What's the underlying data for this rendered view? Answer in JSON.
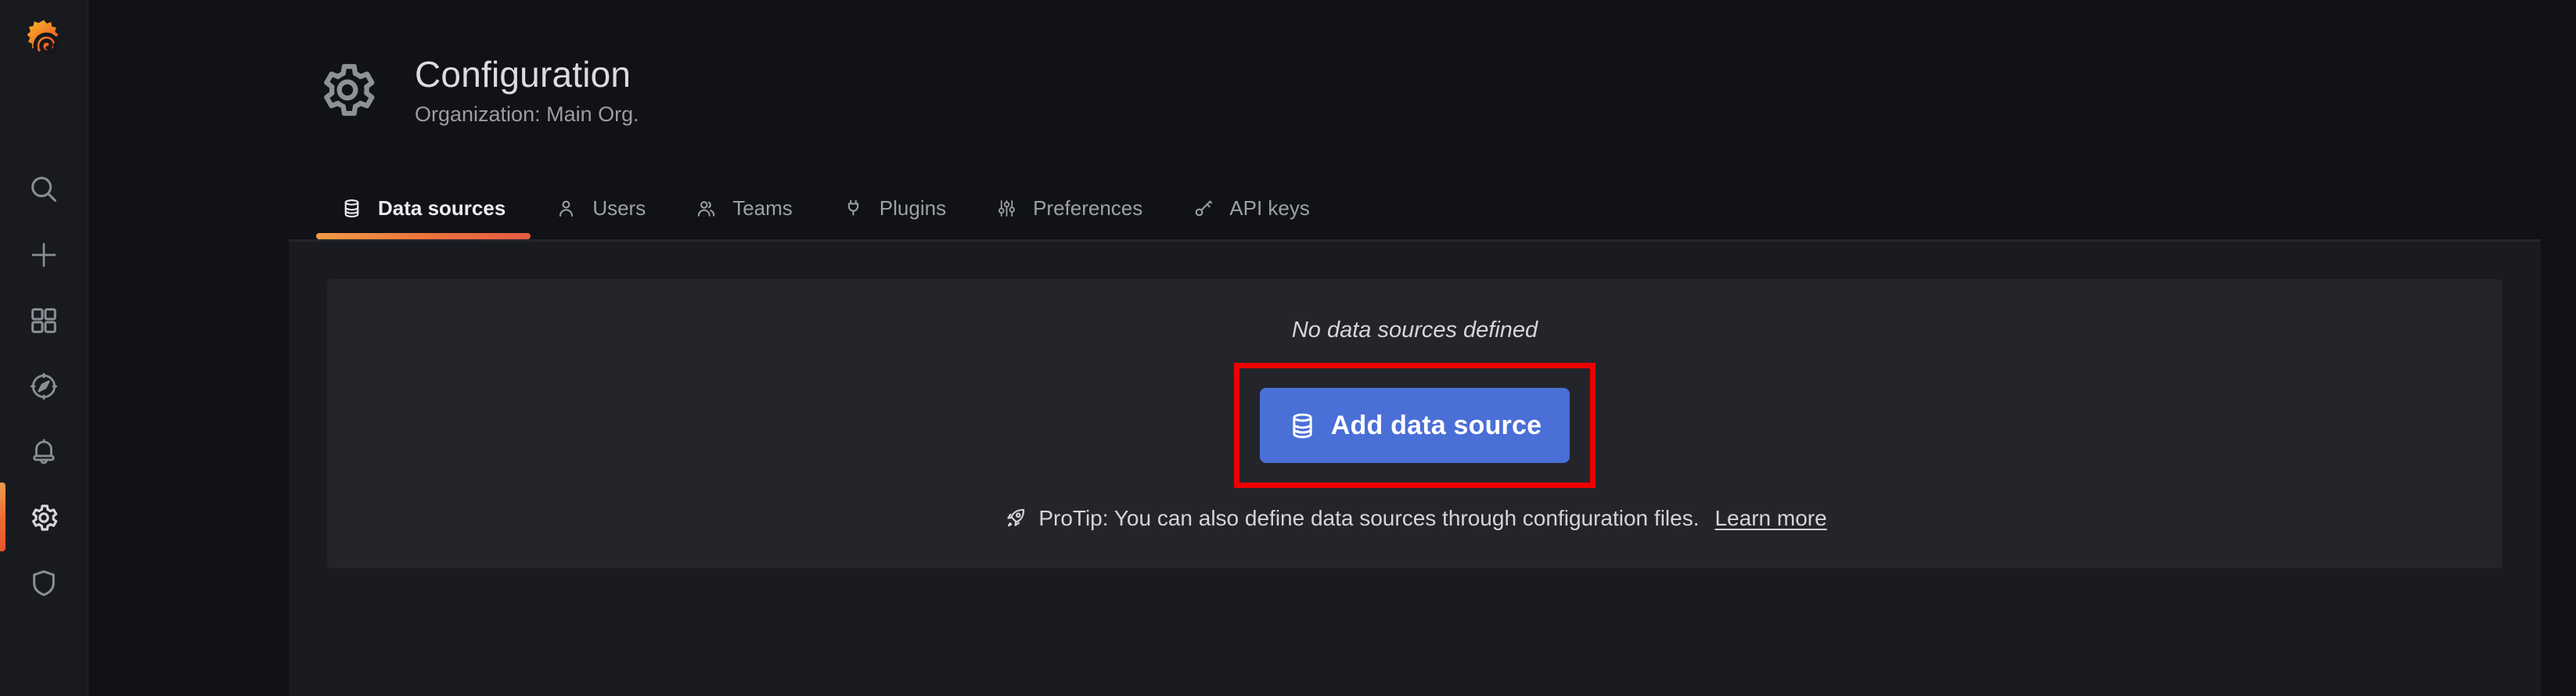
{
  "header": {
    "title": "Configuration",
    "subtitle": "Organization: Main Org."
  },
  "sidebar": {
    "items": [
      {
        "icon": "grafana-logo"
      },
      {
        "icon": "search-icon"
      },
      {
        "icon": "plus-icon"
      },
      {
        "icon": "dashboards-grid-icon"
      },
      {
        "icon": "explore-compass-icon"
      },
      {
        "icon": "alerting-bell-icon"
      },
      {
        "icon": "configuration-gear-icon",
        "active": true
      },
      {
        "icon": "server-admin-shield-icon"
      }
    ]
  },
  "tabs": {
    "items": [
      {
        "label": "Data sources",
        "icon": "database-icon",
        "active": true
      },
      {
        "label": "Users",
        "icon": "user-icon",
        "active": false
      },
      {
        "label": "Teams",
        "icon": "users-icon",
        "active": false
      },
      {
        "label": "Plugins",
        "icon": "plug-icon",
        "active": false
      },
      {
        "label": "Preferences",
        "icon": "sliders-icon",
        "active": false
      },
      {
        "label": "API keys",
        "icon": "key-icon",
        "active": false
      }
    ]
  },
  "content": {
    "empty_message": "No data sources defined",
    "add_button_label": "Add data source",
    "protip_text": "ProTip: You can also define data sources through configuration files.",
    "learn_more_label": "Learn more"
  },
  "colors": {
    "accent_orange_start": "#f19b45",
    "accent_orange_end": "#e75b45",
    "primary_button_blue": "#4a6fd6",
    "annotation_red": "#ee0000",
    "page_background": "#111217",
    "panel_background": "#24252a"
  }
}
